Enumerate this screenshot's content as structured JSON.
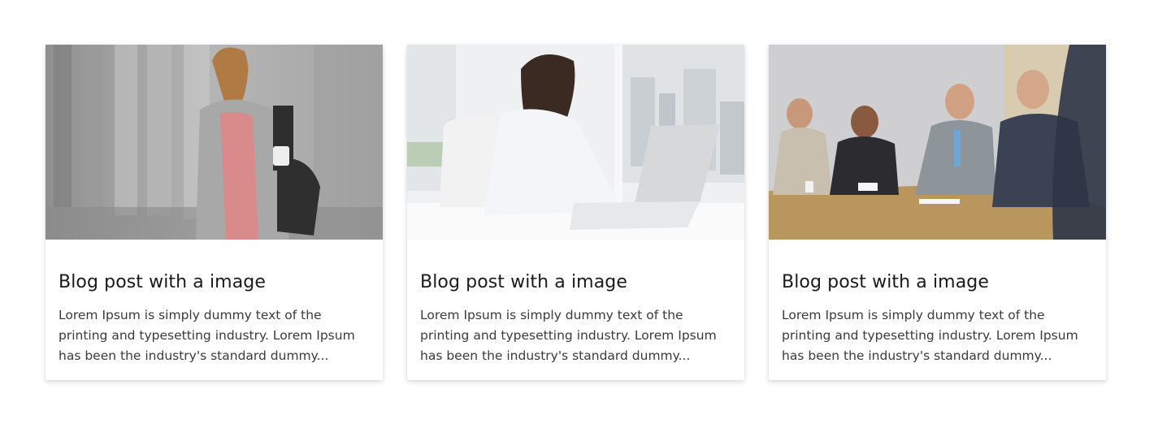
{
  "cards": [
    {
      "image": "woman-on-phone-photo",
      "title": "Blog post with a image",
      "excerpt": "Lorem Ipsum is simply dummy text of the printing and typesetting industry. Lorem Ipsum has been the industry's standard dummy..."
    },
    {
      "image": "woman-at-laptop-photo",
      "title": "Blog post with a image",
      "excerpt": "Lorem Ipsum is simply dummy text of the printing and typesetting industry. Lorem Ipsum has been the industry's standard dummy..."
    },
    {
      "image": "business-meeting-photo",
      "title": "Blog post with a image",
      "excerpt": "Lorem Ipsum is simply dummy text of the printing and typesetting industry. Lorem Ipsum has been the industry's standard dummy..."
    }
  ]
}
